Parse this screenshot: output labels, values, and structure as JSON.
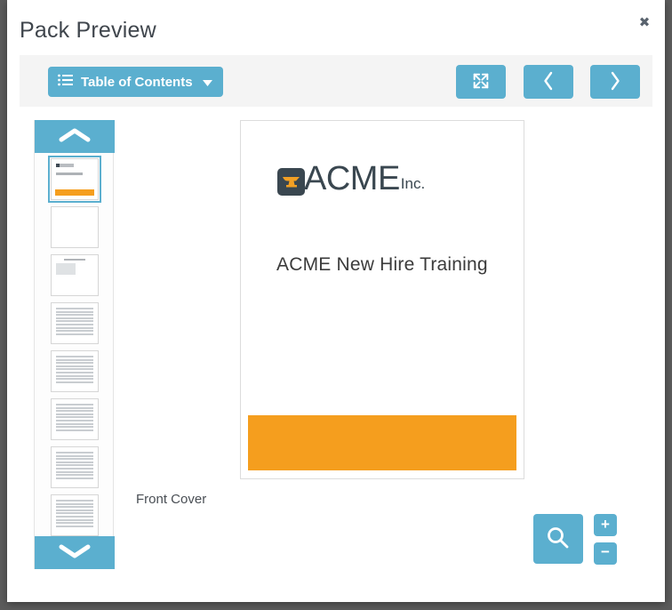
{
  "modal": {
    "title": "Pack Preview",
    "close_label": "✖"
  },
  "toolbar": {
    "toc_label": "Table of Contents",
    "toc_icon": "list-icon",
    "caret_icon": "chevron-down-icon",
    "fullscreen_icon": "expand-arrows-icon",
    "prev_icon": "chevron-left-icon",
    "next_icon": "chevron-right-icon",
    "background": "#f4f4f4"
  },
  "thumbnails": {
    "scroll_up_icon": "chevron-up-icon",
    "scroll_down_icon": "chevron-down-icon",
    "selected_index": 0,
    "items": [
      {
        "kind": "cover",
        "selected": true
      },
      {
        "kind": "blank",
        "selected": false
      },
      {
        "kind": "figure",
        "selected": false
      },
      {
        "kind": "text",
        "selected": false
      },
      {
        "kind": "text",
        "selected": false
      },
      {
        "kind": "text",
        "selected": false
      },
      {
        "kind": "text",
        "selected": false
      },
      {
        "kind": "text",
        "selected": false
      }
    ]
  },
  "slide": {
    "logo_mark_icon": "anvil-icon",
    "logo_text": "ACME",
    "logo_suffix": "Inc.",
    "heading": "ACME New Hire Training",
    "caption": "Front Cover",
    "band_color": "#f59e1e",
    "logo_color": "#3a4750"
  },
  "zoom_controls": {
    "magnify_icon": "search-icon",
    "zoom_in_label": "+",
    "zoom_out_label": "−"
  },
  "colors": {
    "accent": "#5bafcf",
    "orange": "#f59e1e",
    "dark_slate": "#3a4750",
    "backdrop": "#5b5b5b"
  }
}
